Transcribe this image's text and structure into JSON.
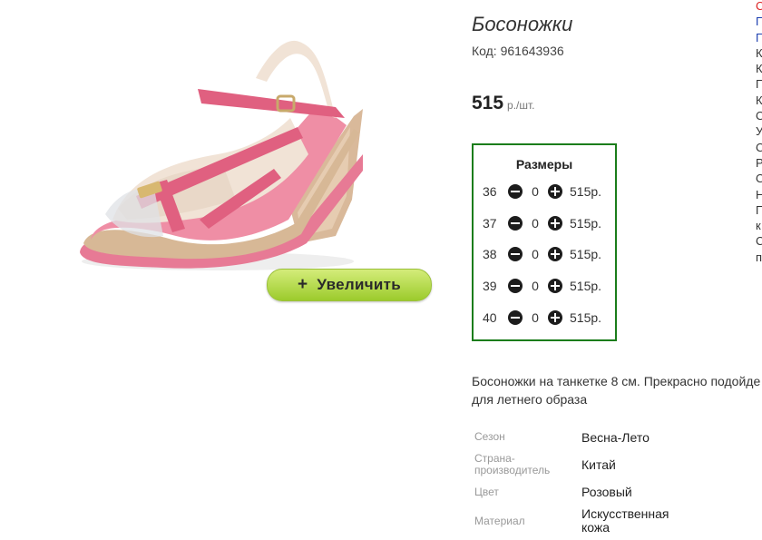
{
  "product": {
    "title": "Босоножки",
    "code_label": "Код: 961643936",
    "price_value": "515",
    "price_unit": "р./шт.",
    "zoom_button_label": "Увеличить",
    "zoom_button_icon": "+"
  },
  "sizes": {
    "title": "Размеры",
    "rows": [
      {
        "size": "36",
        "qty": "0",
        "price": "515р."
      },
      {
        "size": "37",
        "qty": "0",
        "price": "515р."
      },
      {
        "size": "38",
        "qty": "0",
        "price": "515р."
      },
      {
        "size": "39",
        "qty": "0",
        "price": "515р."
      },
      {
        "size": "40",
        "qty": "0",
        "price": "515р."
      }
    ]
  },
  "description": "Босоножки на танкетке 8 см. Прекрасно подойде для летнего образа",
  "characteristics": [
    {
      "label": "Сезон",
      "value": "Весна-Лето"
    },
    {
      "label": "Страна-производитель",
      "value": "Китай"
    },
    {
      "label": "Цвет",
      "value": "Розовый"
    },
    {
      "label": "Материал",
      "value": "Искусственная кожа"
    }
  ],
  "right_column_letters": [
    "С",
    "П",
    "П",
    "К",
    "К",
    "П",
    "К",
    "О",
    "У",
    "С",
    "Р",
    "О",
    "Н",
    "П",
    "к",
    "С",
    "п"
  ],
  "colors": {
    "sizes_border": "#1b7d1b",
    "zoom_button": "#9ccb2c",
    "sandal_pink": "#e06080"
  }
}
